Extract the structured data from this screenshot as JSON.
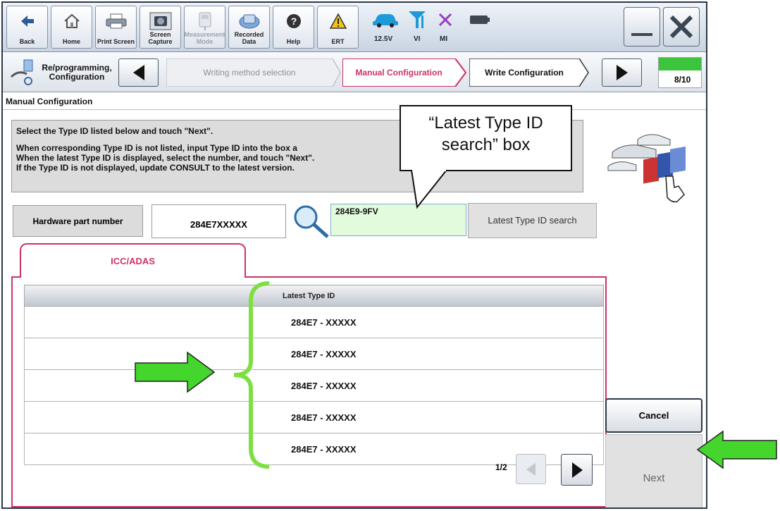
{
  "toolbar": {
    "back": "Back",
    "home": "Home",
    "print_screen": "Print Screen",
    "screen_capture": "Screen Capture",
    "measurement_mode": "Measurement Mode",
    "recorded_data": "Recorded Data",
    "help": "Help",
    "ert": "ERT",
    "battery_voltage": "12.5V",
    "vi": "VI",
    "mi": "MI"
  },
  "steps": {
    "reprogramming": "Re/programming, Configuration",
    "writing_method": "Writing method selection",
    "manual_configuration": "Manual Configuration",
    "write_configuration": "Write Configuration",
    "progress": "8/10"
  },
  "page_title": "Manual Configuration",
  "instructions": {
    "line1": "Select the Type ID listed below and touch \"Next\".",
    "line2": "When corresponding Type ID is not listed, input Type ID into the box a",
    "line3": "When the latest Type ID is displayed, select the number, and touch \"Next\".",
    "line4": "If the Type ID is not displayed, update CONSULT to the latest version."
  },
  "hardware": {
    "label": "Hardware part number",
    "value": "284E7XXXXX"
  },
  "type_id_input": "284E9-9FV",
  "latest_type_button": "Latest Type ID search",
  "tab_label": "ICC/ADAS",
  "table": {
    "header": "Latest Type ID",
    "rows": [
      "284E7 - XXXXX",
      "284E7 - XXXXX",
      "284E7 - XXXXX",
      "284E7 - XXXXX",
      "284E7 - XXXXX"
    ]
  },
  "pager": "1/2",
  "cancel": "Cancel",
  "next": "Next",
  "callout": {
    "line1": "“Latest Type ID",
    "line2": "search” box"
  },
  "colors": {
    "tab_accent": "#cc3366",
    "annotation_green": "#44d62c",
    "input_green_bg": "#e2fbdc"
  }
}
